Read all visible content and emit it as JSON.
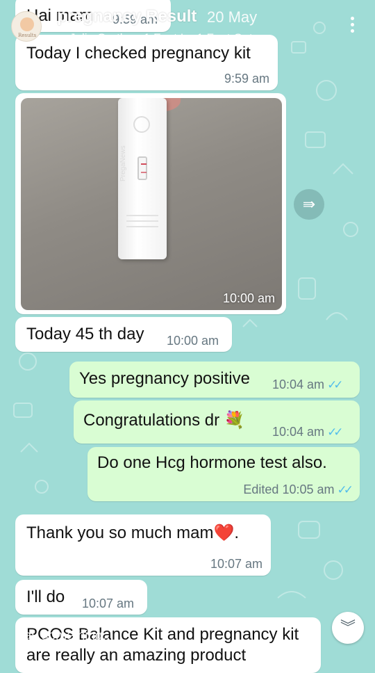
{
  "story": {
    "title": "pregnancy Result",
    "time": "20 May",
    "song": "Julia Gartha · 1 Foot In, 1 Foot Out",
    "avatar_caption": "Results",
    "reply_hint": "Say something..."
  },
  "messages": [
    {
      "dir": "in",
      "text": "Hai mam",
      "time": "9:59 am"
    },
    {
      "dir": "in",
      "text": "Today I checked pregnancy kit",
      "time": "9:59 am"
    },
    {
      "dir": "in",
      "type": "image",
      "image_text": "PregaNews",
      "time": "10:00 am"
    },
    {
      "dir": "in",
      "text": "Today 45 th day",
      "time": "10:00 am"
    },
    {
      "dir": "out",
      "text": "Yes pregnancy positive",
      "time": "10:04 am",
      "status": "read"
    },
    {
      "dir": "out",
      "text": "Congratulations dr 💐",
      "time": "10:04 am",
      "status": "read"
    },
    {
      "dir": "out",
      "text": "Do one Hcg hormone test also.",
      "time": "Edited 10:05 am",
      "status": "read"
    },
    {
      "dir": "in",
      "text": "Thank you so much mam❤️.",
      "time": "10:07 am"
    },
    {
      "dir": "in",
      "text": "I'll do",
      "time": "10:07 am"
    },
    {
      "dir": "in",
      "text": "PCOS Balance Kit  and pregnancy kit are  really an amazing product"
    }
  ],
  "icons": {
    "forward": "forward-icon",
    "scroll_down": "double-chevron-down-icon",
    "menu": "kebab-menu-icon",
    "music": "music-note-icon",
    "read_receipt": "double-check-icon"
  },
  "colors": {
    "wallpaper": "#9fdcd6",
    "incoming": "#ffffff",
    "outgoing": "#d9fdd3",
    "read_ticks": "#53bdeb",
    "timestamp": "#667781"
  }
}
